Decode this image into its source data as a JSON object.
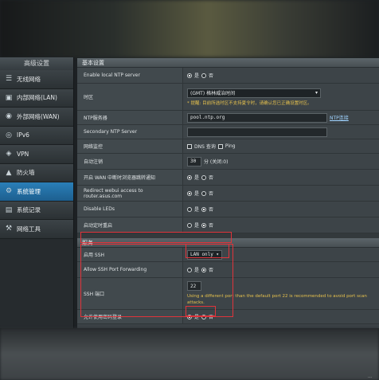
{
  "sidebar": {
    "header": "高级设置",
    "items": [
      {
        "label": "无线网络",
        "icon": "wifi-icon"
      },
      {
        "label": "内部网络(LAN)",
        "icon": "lan-icon"
      },
      {
        "label": "外部网络(WAN)",
        "icon": "globe-icon"
      },
      {
        "label": "IPv6",
        "icon": "ipv6-icon"
      },
      {
        "label": "VPN",
        "icon": "vpn-icon"
      },
      {
        "label": "防火墙",
        "icon": "firewall-icon"
      },
      {
        "label": "系统管理",
        "icon": "gear-icon",
        "active": true
      },
      {
        "label": "系统记录",
        "icon": "log-icon"
      },
      {
        "label": "网络工具",
        "icon": "tools-icon"
      }
    ]
  },
  "basic": {
    "header": "基本设置",
    "ntp_client_label": "Enable local NTP server",
    "yes": "是",
    "no": "否",
    "timezone_label": "时区",
    "timezone_value": "(GMT) 格林威治时间",
    "timezone_hint": "* 提醒: 目前所选时区不支持夏令时，请确认您已正确设置时区。",
    "ntp_server_label": "NTP服务器",
    "ntp_server_value": "pool.ntp.org",
    "ntp_link": "NTP连接",
    "secondary_ntp_label": "Secondary NTP Server",
    "secondary_ntp_value": "",
    "network_monitor_label": "网络监控",
    "dns_query": "DNS 查询",
    "ping": "Ping",
    "auto_logout_label": "自动注销",
    "auto_logout_value": "30",
    "auto_logout_unit": "分 (关闭:0)",
    "wan_notify_label": "开启 WAN 中断时浏览器跳转通知",
    "redirect_label": "Redirect webui access to router.asus.com",
    "disable_leds_label": "Disable LEDs",
    "reboot_label": "启动定时重启"
  },
  "service": {
    "header": "服务",
    "ssh_label": "启用 SSH",
    "ssh_value": "LAN only",
    "ssh_forward_label": "Allow SSH Port Forwarding",
    "ssh_port_label": "SSH 端口",
    "ssh_port_value": "22",
    "ssh_port_hint": "Using a different port than the default port 22 is recommended to avoid port scan attacks.",
    "password_login_label": "允许使用密码登录",
    "password_login_yes": "是",
    "password_login_no": "否"
  },
  "colors": {
    "active_item": "#2a7fb8",
    "highlight": "#e0343b",
    "hint": "#e5c04d",
    "link": "#9fd3ff"
  }
}
